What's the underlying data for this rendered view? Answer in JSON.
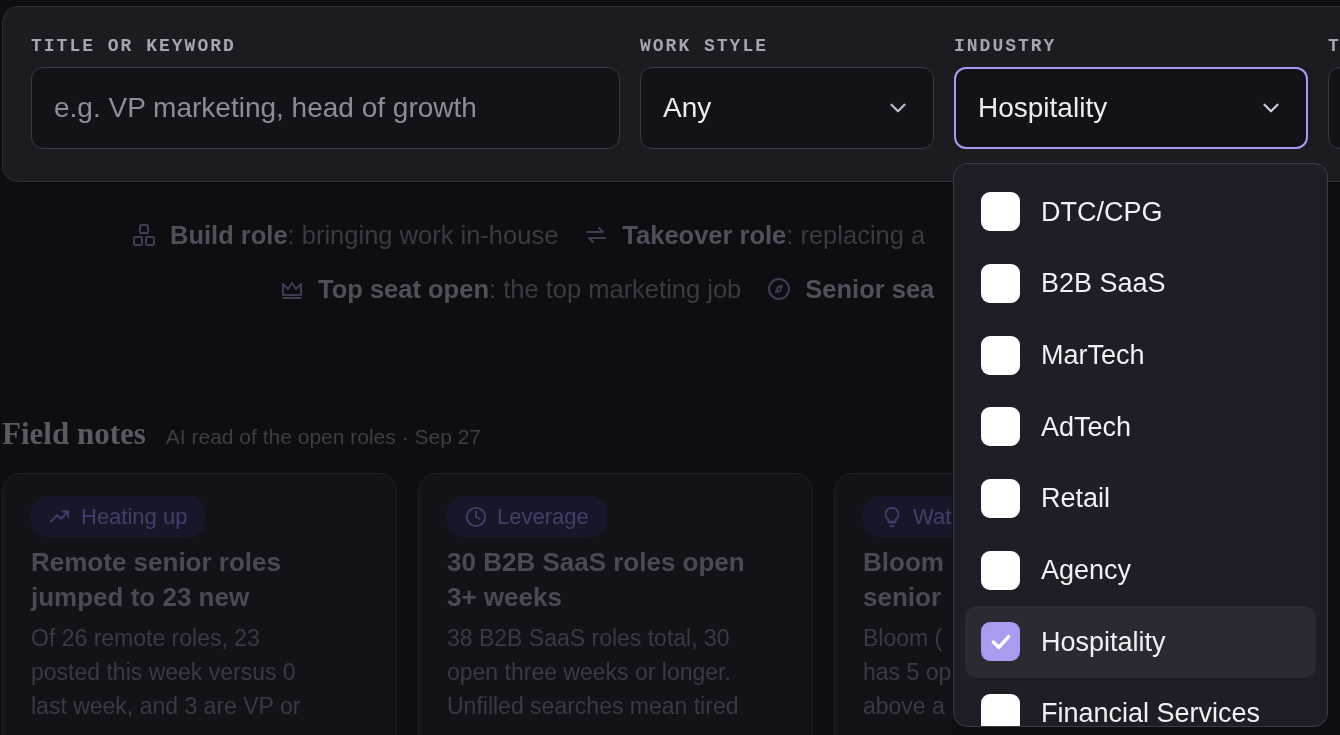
{
  "filters": [
    {
      "label": "TITLE OR KEYWORD",
      "kind": "text",
      "placeholder": "e.g. VP marketing, head of growth"
    },
    {
      "label": "WORK STYLE",
      "kind": "select",
      "value": "Any",
      "focused": false
    },
    {
      "label": "INDUSTRY",
      "kind": "select",
      "value": "Hospitality",
      "focused": true
    },
    {
      "label": "T",
      "kind": "select",
      "focused": false
    }
  ],
  "industry_menu": {
    "options": [
      {
        "label": "DTC/CPG",
        "checked": false,
        "highlighted": false
      },
      {
        "label": "B2B SaaS",
        "checked": false,
        "highlighted": false
      },
      {
        "label": "MarTech",
        "checked": false,
        "highlighted": false
      },
      {
        "label": "AdTech",
        "checked": false,
        "highlighted": false
      },
      {
        "label": "Retail",
        "checked": false,
        "highlighted": false
      },
      {
        "label": "Agency",
        "checked": false,
        "highlighted": false
      },
      {
        "label": "Hospitality",
        "checked": true,
        "highlighted": true
      },
      {
        "label": "Financial Services",
        "checked": false,
        "highlighted": false
      }
    ]
  },
  "legend": [
    [
      {
        "kind": "build",
        "text": "**Build role**: bringing work in-house"
      },
      {
        "kind": "takeover",
        "text": "**Takeover role**: replacing a"
      }
    ],
    [
      {
        "kind": "crown",
        "text": "**Top seat open**: the top marketing job"
      },
      {
        "kind": "compass",
        "text": "**Senior sea**"
      }
    ]
  ],
  "field_notes": {
    "title": "Field notes",
    "subtitle": "AI read of the open roles · Sep 27",
    "cards": [
      {
        "tag": {
          "kind": "trend",
          "label": "Heating up"
        },
        "title_lines": [
          "Remote senior roles",
          "jumped to 23 new"
        ],
        "body_lines": [
          "Of 26 remote roles, 23",
          "posted this week versus 0",
          "last week, and 3 are VP or"
        ]
      },
      {
        "tag": {
          "kind": "clock",
          "label": "Leverage"
        },
        "title_lines": [
          "30 B2B SaaS roles open",
          "3+ weeks"
        ],
        "body_lines": [
          "38 B2B SaaS roles total, 30",
          "open three weeks or longer.",
          "Unfilled searches mean tired"
        ]
      },
      {
        "tag": {
          "kind": "bulb",
          "label": "Wat"
        },
        "title_lines": [
          "Bloom",
          "senior"
        ],
        "body_lines": [
          "Bloom (",
          "has 5 op",
          "above a"
        ]
      }
    ]
  }
}
